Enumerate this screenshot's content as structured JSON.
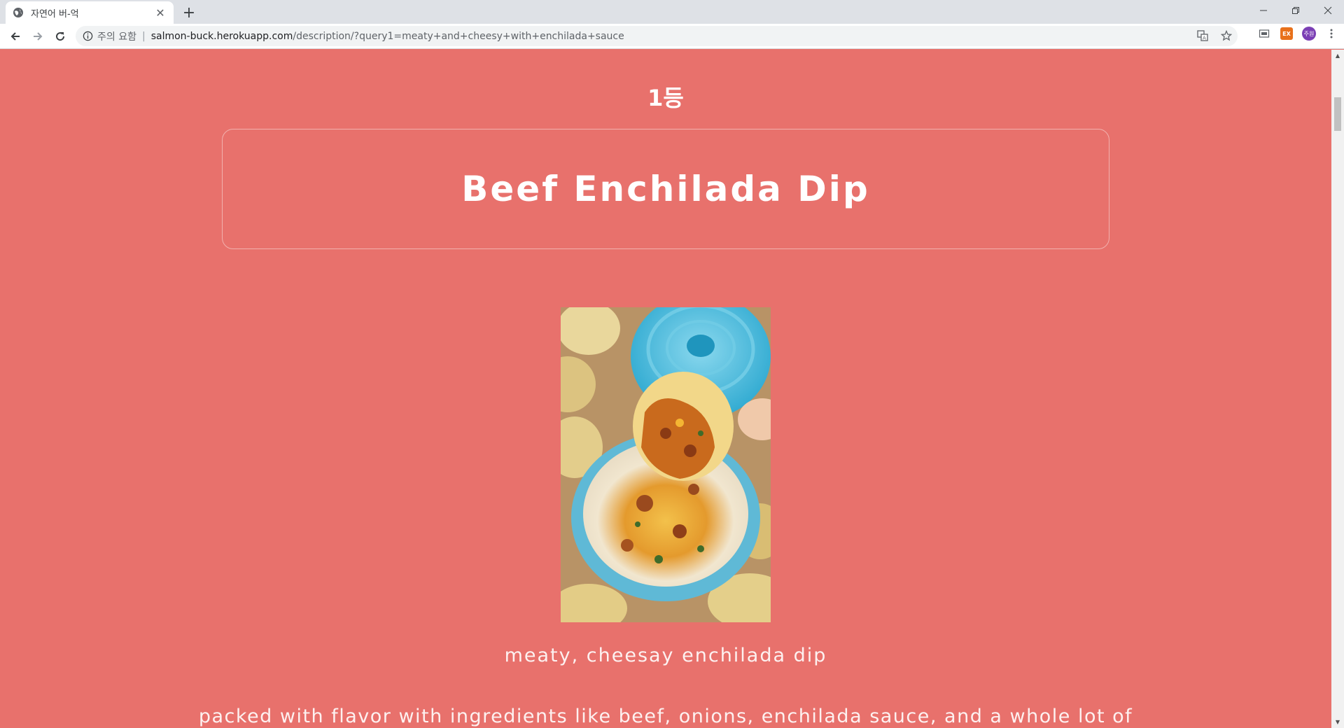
{
  "browser": {
    "tab": {
      "title": "자연어 버-억",
      "favicon": "globe-icon",
      "close_icon": "close-icon"
    },
    "new_tab_icon": "plus-icon",
    "window_controls": [
      "minimize-icon",
      "restore-icon",
      "close-icon"
    ],
    "address_bar": {
      "security_label": "주의 요함",
      "security_icon": "info-icon",
      "url_host": "salmon-buck.herokuapp.com",
      "url_path": "/description/?query1=meaty+and+cheesy+with+enchilada+sauce"
    },
    "extension_badge": "EX",
    "profile_initials": "주원"
  },
  "recipe": {
    "rank": "1등",
    "title": "Beef Enchilada Dip",
    "caption": "meaty, cheesay enchilada dip",
    "description": "packed with flavor with ingredients like beef, onions, enchilada sauce, and a whole lot of"
  },
  "colors": {
    "page_background": "#e8716c",
    "text": "#ffffff"
  }
}
